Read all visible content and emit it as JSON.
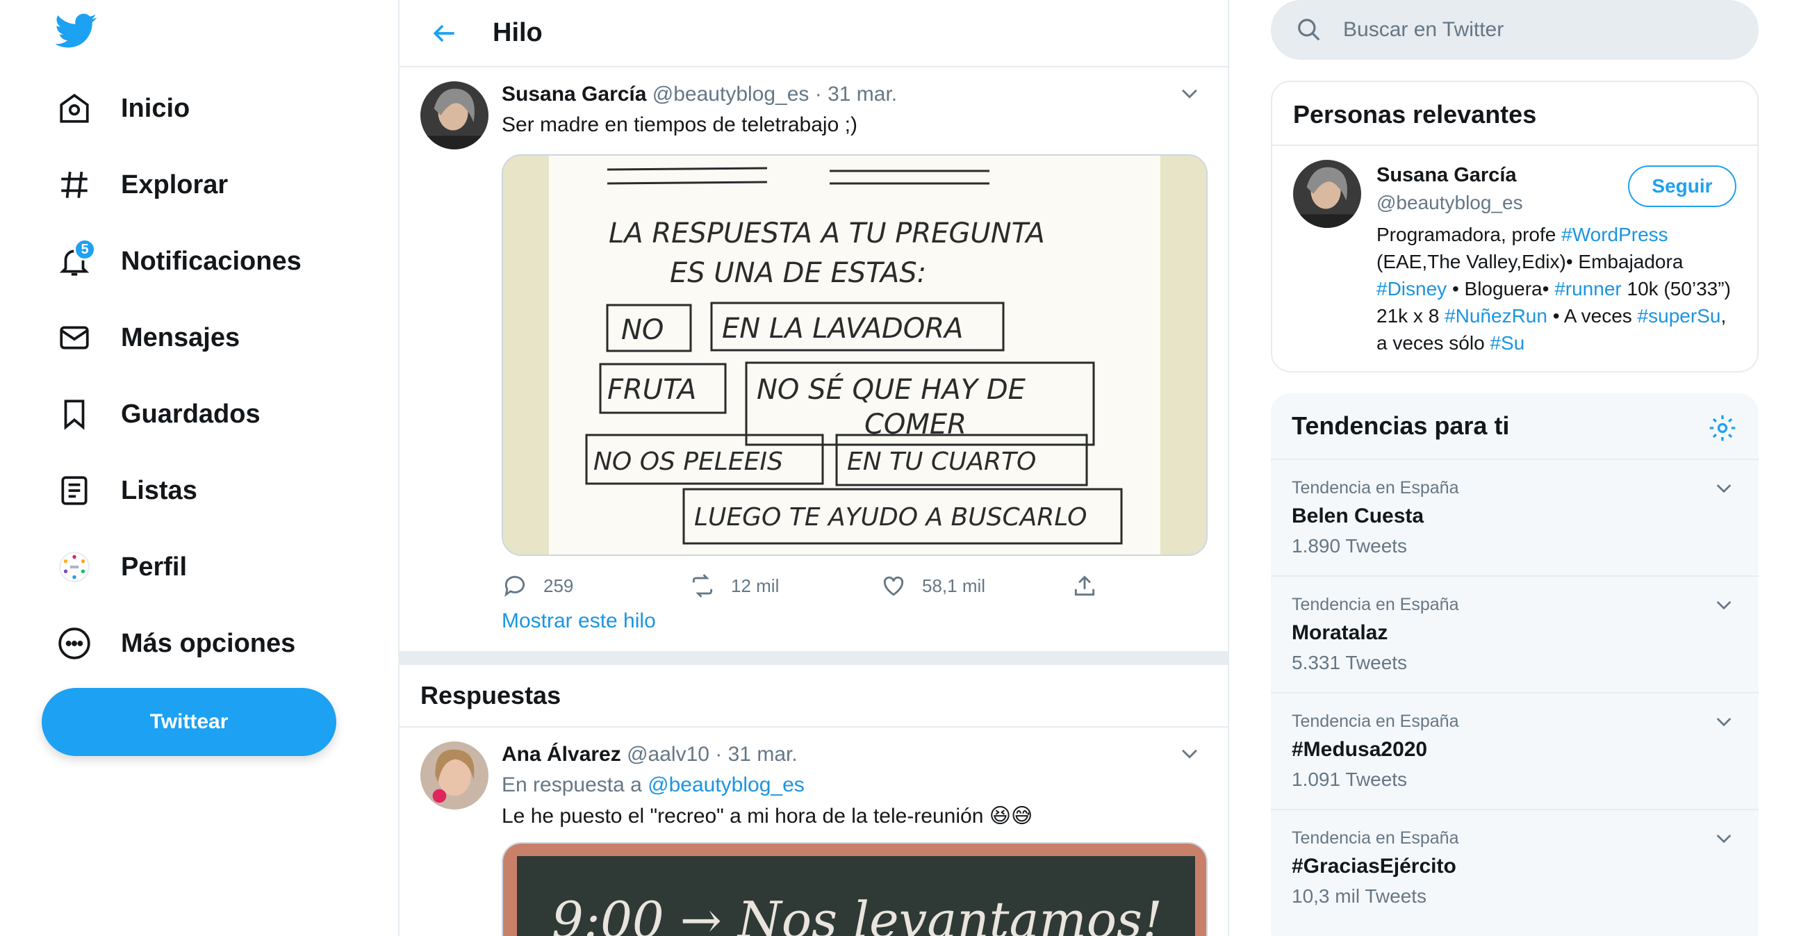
{
  "colors": {
    "accent": "#1da1f2",
    "link": "#1b95e0",
    "muted": "#657786",
    "text": "#14171a",
    "divider": "#e6ecf0"
  },
  "nav": {
    "logo_icon": "twitter-bird-icon",
    "items": [
      {
        "label": "Inicio",
        "icon": "home-icon"
      },
      {
        "label": "Explorar",
        "icon": "hashtag-icon"
      },
      {
        "label": "Notificaciones",
        "icon": "bell-icon",
        "badge": "5"
      },
      {
        "label": "Mensajes",
        "icon": "envelope-icon"
      },
      {
        "label": "Guardados",
        "icon": "bookmark-icon"
      },
      {
        "label": "Listas",
        "icon": "list-icon"
      },
      {
        "label": "Perfil",
        "icon": "avatar-icon"
      },
      {
        "label": "Más opciones",
        "icon": "more-dots-icon"
      }
    ],
    "tweet_button": "Twittear"
  },
  "header": {
    "title": "Hilo"
  },
  "main_tweet": {
    "name": "Susana García",
    "handle": "@beautyblog_es",
    "date": "· 31 mar.",
    "text": "Ser madre en tiempos de teletrabajo ;)",
    "image_text": {
      "line1": "LA RESPUESTA A TU PREGUNTA",
      "line2": "ES UNA DE ESTAS:",
      "box1": "NO",
      "box2": "EN LA LAVADORA",
      "box3": "FRUTA",
      "box4a": "NO SÉ QUE HAY DE",
      "box4b": "COMER",
      "box5": "NO OS PELEEIS",
      "box6": "EN TU CUARTO",
      "box7": "LUEGO TE AYUDO A BUSCARLO"
    },
    "replies": "259",
    "retweets": "12 mil",
    "likes": "58,1 mil",
    "show_thread": "Mostrar este hilo"
  },
  "replies_section": {
    "title": "Respuestas"
  },
  "reply_tweet": {
    "name": "Ana Álvarez",
    "handle": "@aalv10",
    "date": "· 31 mar.",
    "reply_prefix": "En respuesta a",
    "reply_to": "@beautyblog_es",
    "text": "Le he puesto el \"recreo\" a mi hora de la tele-reunión 😆😅",
    "image_text": "9:00 → Nos levantamos!"
  },
  "search": {
    "placeholder": "Buscar en Twitter"
  },
  "relevant_people": {
    "title": "Personas relevantes",
    "name": "Susana García",
    "handle": "@beautyblog_es",
    "follow": "Seguir",
    "bio": [
      {
        "t": "Programadora, profe "
      },
      {
        "t": "#WordPress",
        "link": true
      },
      {
        "t": " (EAE,The Valley,Edix)• Embajadora "
      },
      {
        "t": "#Disney",
        "link": true
      },
      {
        "t": " • Bloguera• "
      },
      {
        "t": "#runner",
        "link": true
      },
      {
        "t": " 10k (50’33”) 21k x 8 "
      },
      {
        "t": "#NuñezRun",
        "link": true
      },
      {
        "t": " • A veces "
      },
      {
        "t": "#superSu",
        "link": true
      },
      {
        "t": ", a veces sólo "
      },
      {
        "t": "#Su",
        "link": true
      }
    ]
  },
  "trends": {
    "title": "Tendencias para ti",
    "items": [
      {
        "context": "Tendencia en España",
        "name": "Belen Cuesta",
        "count": "1.890 Tweets"
      },
      {
        "context": "Tendencia en España",
        "name": "Moratalaz",
        "count": "5.331 Tweets"
      },
      {
        "context": "Tendencia en España",
        "name": "#Medusa2020",
        "count": "1.091 Tweets"
      },
      {
        "context": "Tendencia en España",
        "name": "#GraciasEjército",
        "count": "10,3 mil Tweets"
      }
    ]
  }
}
